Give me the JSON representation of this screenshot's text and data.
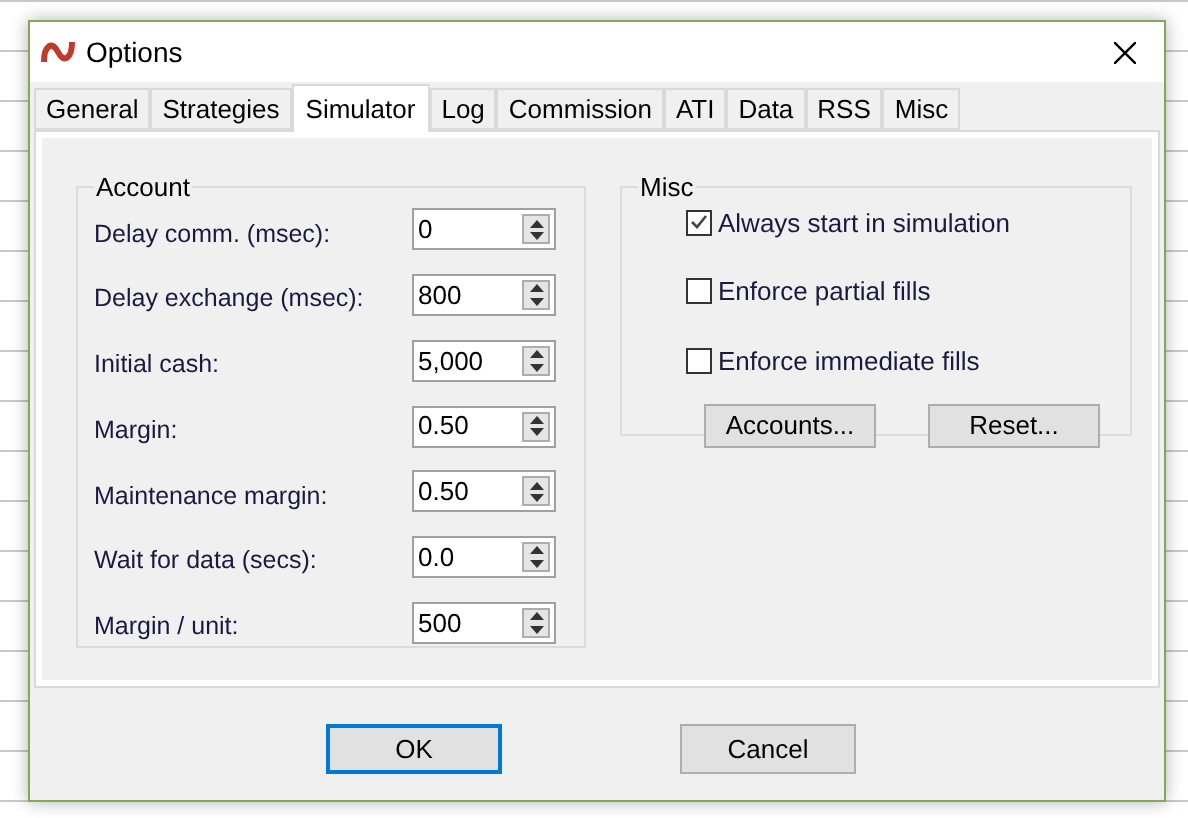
{
  "window": {
    "title": "Options"
  },
  "tabs": [
    {
      "label": "General",
      "selected": false
    },
    {
      "label": "Strategies",
      "selected": false
    },
    {
      "label": "Simulator",
      "selected": true
    },
    {
      "label": "Log",
      "selected": false
    },
    {
      "label": "Commission",
      "selected": false
    },
    {
      "label": "ATI",
      "selected": false
    },
    {
      "label": "Data",
      "selected": false
    },
    {
      "label": "RSS",
      "selected": false
    },
    {
      "label": "Misc",
      "selected": false
    }
  ],
  "account": {
    "title": "Account",
    "fields": [
      {
        "label": "Delay comm. (msec):",
        "value": "0"
      },
      {
        "label": "Delay exchange (msec):",
        "value": "800"
      },
      {
        "label": "Initial cash:",
        "value": "5,000"
      },
      {
        "label": "Margin:",
        "value": "0.50"
      },
      {
        "label": "Maintenance margin:",
        "value": "0.50"
      },
      {
        "label": "Wait for data (secs):",
        "value": "0.0"
      },
      {
        "label": "Margin / unit:",
        "value": "500"
      }
    ]
  },
  "misc": {
    "title": "Misc",
    "options": [
      {
        "label": "Always start in simulation",
        "checked": true
      },
      {
        "label": "Enforce partial fills",
        "checked": false
      },
      {
        "label": "Enforce immediate fills",
        "checked": false
      }
    ],
    "buttons": [
      "Accounts...",
      "Reset..."
    ]
  },
  "buttons": [
    {
      "label": "OK",
      "default": true
    },
    {
      "label": "Cancel",
      "default": false
    }
  ]
}
